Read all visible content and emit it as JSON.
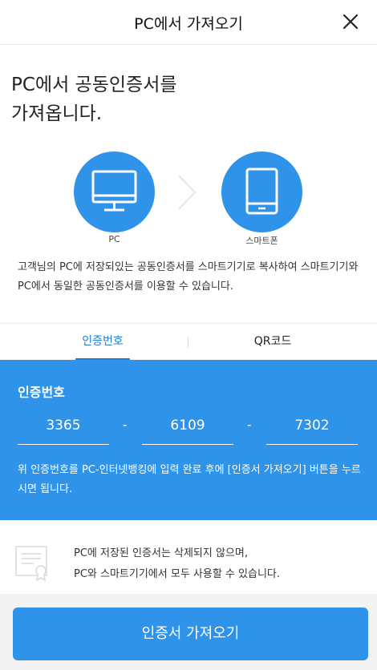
{
  "header": {
    "title": "PC에서 가져오기",
    "close_icon": "close-icon"
  },
  "intro": {
    "headline_line1": "PC에서 공동인증서를",
    "headline_line2": "가져옵니다."
  },
  "devices": {
    "source_label": "PC",
    "target_label": "스마트폰",
    "source_icon": "monitor-icon",
    "target_icon": "smartphone-icon",
    "arrow_icon": "chevron-right-icon"
  },
  "description": "고객님의 PC에 저장되있는 공동인증서를 스마트기기로 복사하여 스마트기기와 PC에서 동일한 공동인증서를 이용할 수 있습니다.",
  "tabs": [
    {
      "label": "인증번호",
      "active": true
    },
    {
      "label": "QR코드",
      "active": false
    }
  ],
  "auth_panel": {
    "title": "인증번호",
    "codes": [
      "3365",
      "6109",
      "7302"
    ],
    "separator": "-",
    "guide": "위 인증번호를 PC-인터넷뱅킹에 입력 완료 후에 [인증서 가져오기] 버튼을 누르시면 됩니다."
  },
  "notice": {
    "icon": "certificate-icon",
    "line1": "PC에 저장된 인증서는 삭제되지 않으며,",
    "line2": "PC와 스마트기기에서 모두 사용할 수 있습니다."
  },
  "footer": {
    "button_label": "인증서 가져오기"
  },
  "colors": {
    "accent": "#2f93ea",
    "tab_active": "#1f7fd8",
    "footer_bg": "#f3f3f3"
  }
}
